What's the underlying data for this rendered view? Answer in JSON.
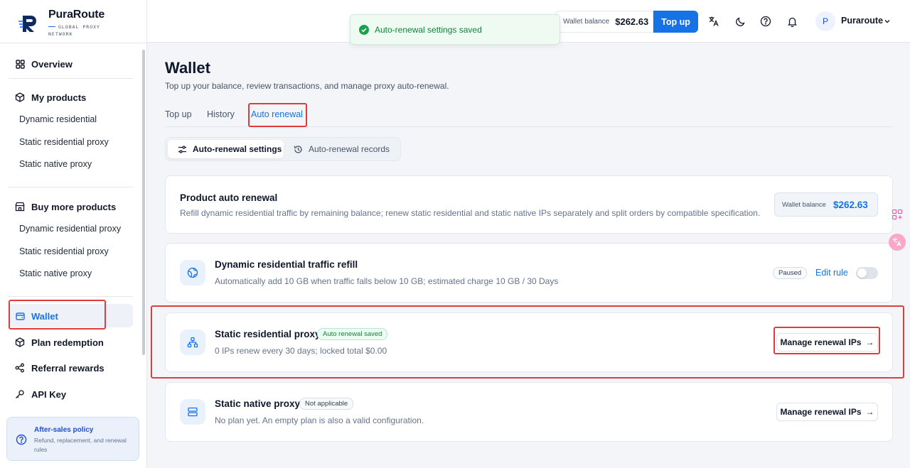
{
  "brand": {
    "name": "PuraRoute",
    "tagline_line1": "GLOBAL PROXY",
    "tagline_line2": "NETWORK"
  },
  "sidebar": {
    "overview": "Overview",
    "my_products": {
      "label": "My products",
      "items": [
        "Dynamic residential",
        "Static residential proxy",
        "Static native proxy"
      ]
    },
    "buy_more": {
      "label": "Buy more products",
      "items": [
        "Dynamic residential proxy",
        "Static residential proxy",
        "Static native proxy"
      ]
    },
    "wallet": "Wallet",
    "plan_redemption": "Plan redemption",
    "referral": "Referral rewards",
    "api_key": "API Key",
    "after_sales": {
      "title": "After-sales policy",
      "desc": "Refund, replacement, and renewal rules"
    }
  },
  "header": {
    "toast": "Auto-renewal settings saved",
    "wallet_label": "Wallet balance",
    "wallet_value": "$262.63",
    "topup": "Top up",
    "user_initial": "P",
    "user_name": "Puraroute"
  },
  "page": {
    "title": "Wallet",
    "subtitle": "Top up your balance, review transactions, and manage proxy auto-renewal.",
    "tabs": [
      "Top up",
      "History",
      "Auto renewal"
    ],
    "active_tab": "Auto renewal",
    "segments": [
      "Auto-renewal settings",
      "Auto-renewal records"
    ]
  },
  "summary": {
    "title": "Product auto renewal",
    "desc": "Refill dynamic residential traffic by remaining balance; renew static residential and static native IPs separately and split orders by compatible specification.",
    "balance_label": "Wallet balance",
    "balance_value": "$262.63"
  },
  "products": [
    {
      "title": "Dynamic residential traffic refill",
      "desc": "Automatically add 10 GB when traffic falls below 10 GB; estimated charge 10 GB / 30 Days",
      "badge": "Paused",
      "action": "Edit rule",
      "enabled": false
    },
    {
      "title": "Static residential proxy",
      "badge": "Auto renewal saved",
      "desc": "0 IPs renew every 30 days; locked total $0.00",
      "action": "Manage renewal IPs"
    },
    {
      "title": "Static native proxy",
      "badge": "Not applicable",
      "desc": "No plan yet. An empty plan is also a valid configuration.",
      "action": "Manage renewal IPs"
    }
  ],
  "colors": {
    "accent": "#1673e6",
    "highlight": "#e03c3c",
    "success": "#16803c"
  }
}
